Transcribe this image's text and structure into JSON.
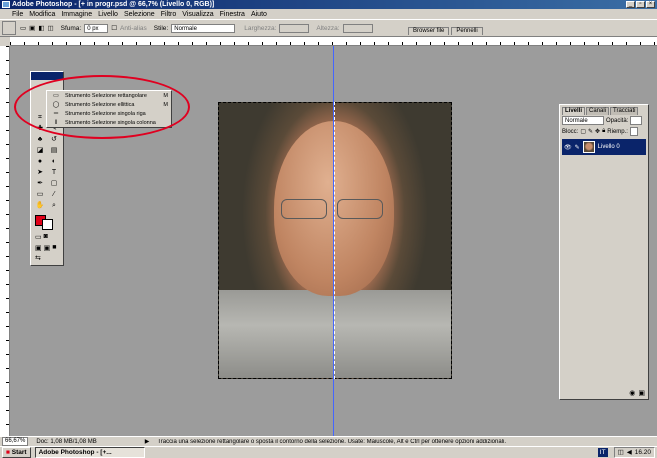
{
  "window": {
    "title": "Adobe Photoshop - [+ in progr.psd @ 66,7% (Livello 0, RGB)]",
    "min_btn": "_",
    "max_btn": "▫",
    "close_btn": "×"
  },
  "menubar": {
    "items": [
      "File",
      "Modifica",
      "Immagine",
      "Livello",
      "Selezione",
      "Filtro",
      "Visualizza",
      "Finestra",
      "Aiuto"
    ]
  },
  "options": {
    "sfuma_label": "Sfuma:",
    "sfuma_value": "0 px",
    "antialias_label": "Anti-alias",
    "stile_label": "Stile:",
    "stile_value": "Normale",
    "larghezza_label": "Larghezza:",
    "altezza_label": "Altezza:"
  },
  "browser_tabs": [
    "Browser file",
    "Pennelli"
  ],
  "flyout": {
    "items": [
      {
        "icon": "▭",
        "label": "Strumento Selezione rettangolare",
        "key": "M"
      },
      {
        "icon": "◯",
        "label": "Strumento Selezione ellittica",
        "key": "M"
      },
      {
        "icon": "═",
        "label": "Strumento Selezione singola riga",
        "key": ""
      },
      {
        "icon": "‖",
        "label": "Strumento Selezione singola colonna",
        "key": ""
      }
    ]
  },
  "layers_palette": {
    "tabs": [
      "Livelli",
      "Canali",
      "Tracciati"
    ],
    "blend_mode": "Normale",
    "opacity_label": "Opacità:",
    "lock_label": "Blocc:",
    "fill_label": "Riemp.:",
    "layer_name": "Livello 0"
  },
  "status": {
    "zoom": "66,67%",
    "doc": "Doc: 1,08 MB/1,08 MB",
    "hint": "Traccia una selezione rettangolare o sposta il contorno della selezione. Usate: Maiuscole, Alt e Ctrl per ottenere opzioni addizionali."
  },
  "taskbar": {
    "start_label": "Start",
    "task_label": "Adobe Photoshop - [+...",
    "lang": "IT",
    "clock": "16.20"
  },
  "colors": {
    "foreground": "#e00018",
    "background": "#ffffff",
    "annotation": "#e00020"
  }
}
